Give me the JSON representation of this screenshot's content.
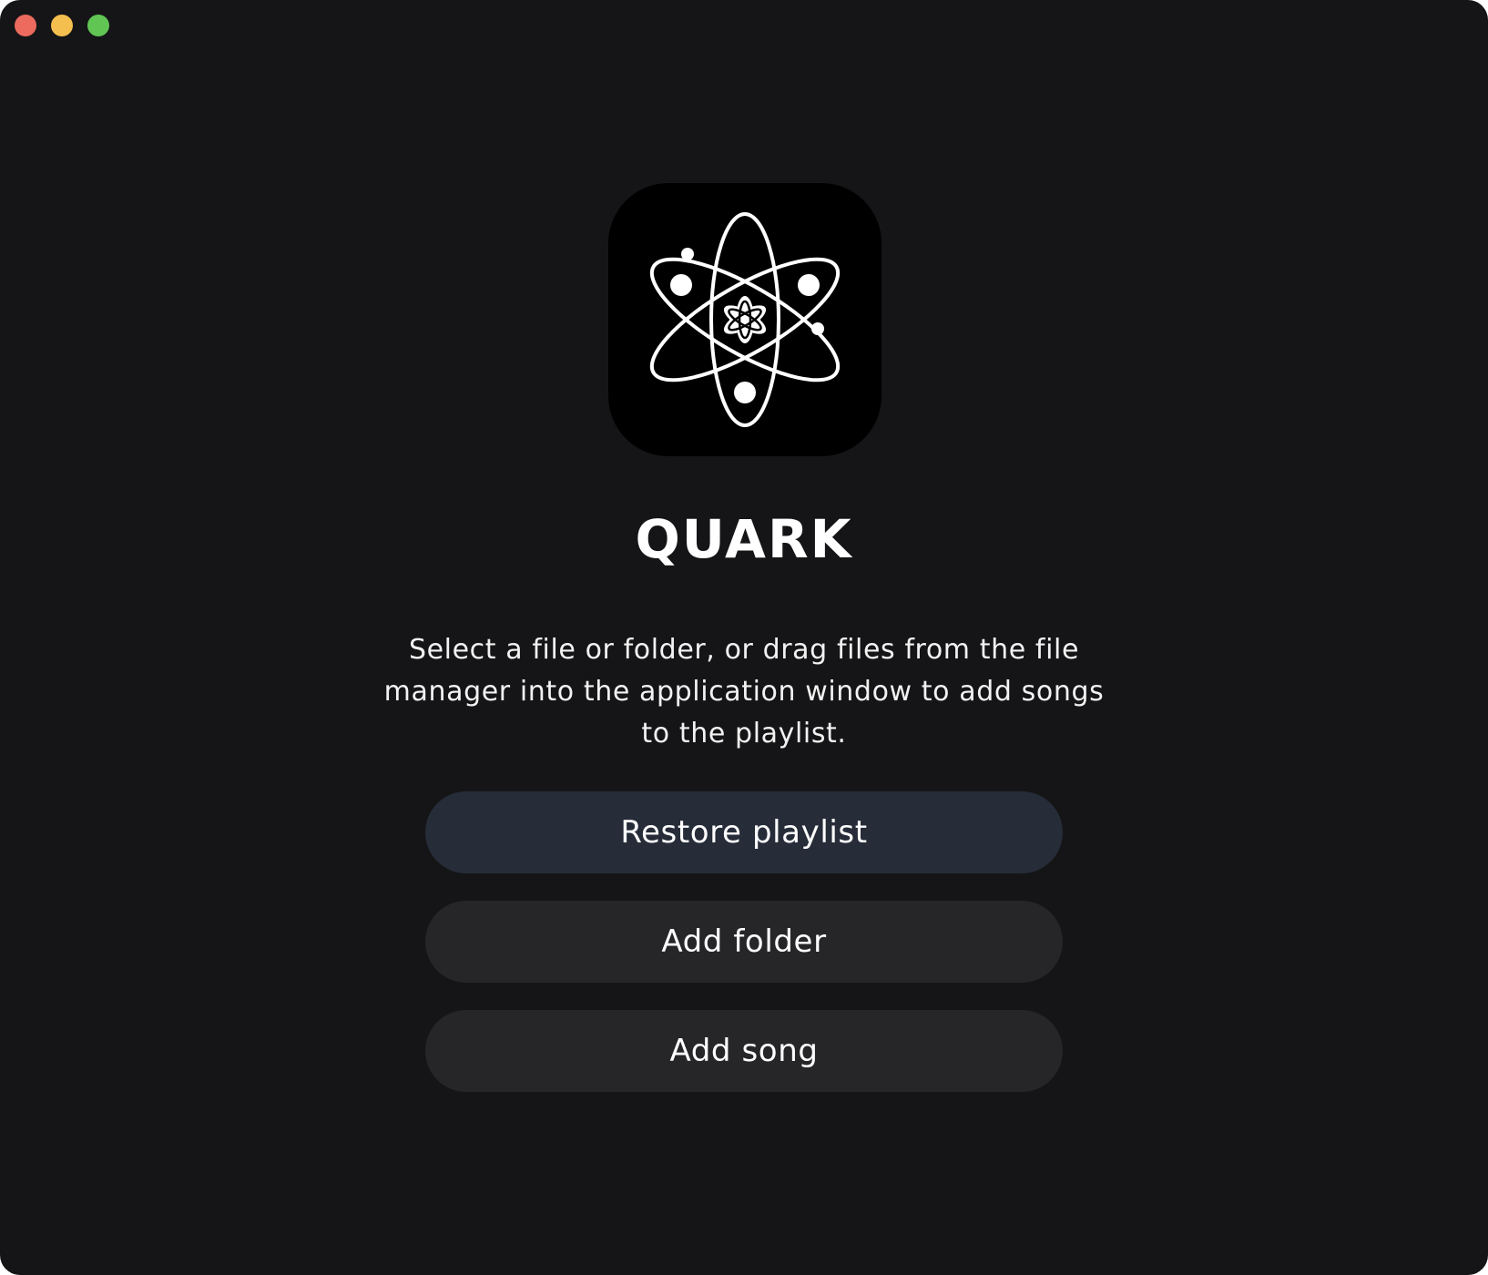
{
  "window": {
    "traffic_lights": {
      "close_color": "#ec6a5e",
      "minimize_color": "#f4bf4f",
      "maximize_color": "#61c554"
    }
  },
  "app": {
    "icon": "atom-icon",
    "title": "QUARK",
    "description": "Select a file or folder, or drag files from the file manager into the application window to add songs to the playlist."
  },
  "actions": {
    "restore_playlist": "Restore playlist",
    "add_folder": "Add folder",
    "add_song": "Add song"
  },
  "colors": {
    "background": "#151517",
    "primary_button": "#262d39",
    "secondary_button": "#262629",
    "text": "#ffffff"
  }
}
